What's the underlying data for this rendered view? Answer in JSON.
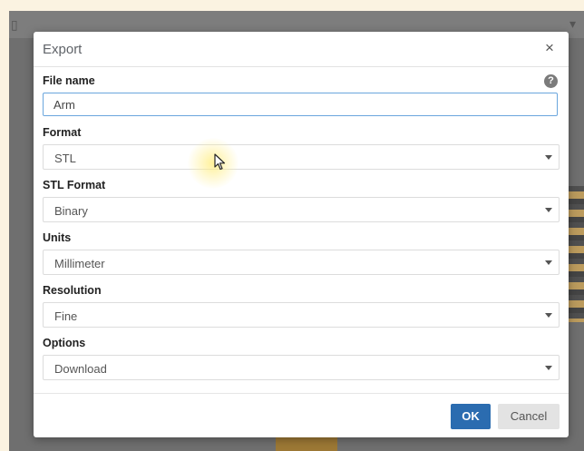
{
  "dialog": {
    "title": "Export",
    "close_glyph": "×",
    "help_glyph": "?",
    "ok_label": "OK",
    "cancel_label": "Cancel"
  },
  "fields": {
    "file_name": {
      "label": "File name",
      "value": "Arm"
    },
    "format": {
      "label": "Format",
      "value": "STL"
    },
    "stl_format": {
      "label": "STL Format",
      "value": "Binary"
    },
    "units": {
      "label": "Units",
      "value": "Millimeter"
    },
    "resolution": {
      "label": "Resolution",
      "value": "Fine"
    },
    "options": {
      "label": "Options",
      "value": "Download"
    }
  },
  "icons": {
    "close": "close-icon",
    "help": "help-icon",
    "caret": "chevron-down-icon",
    "cursor": "mouse-pointer-icon"
  },
  "colors": {
    "primary_button": "#2b6cb0",
    "input_focus_border": "#6aa6dd",
    "backdrop": "#6f6f6f"
  }
}
